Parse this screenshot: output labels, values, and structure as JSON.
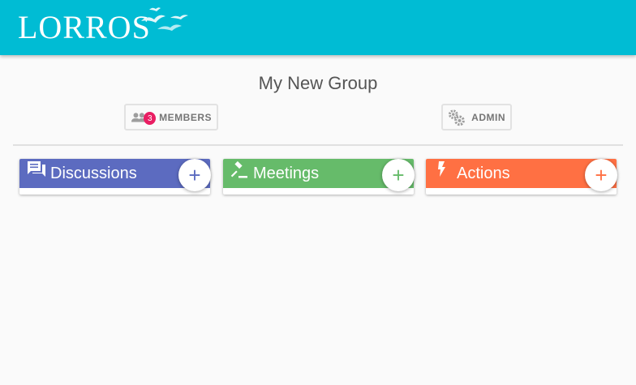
{
  "app": {
    "logo_text": "LORROS",
    "brand_color": "#00bcd4"
  },
  "group": {
    "title": "My New Group"
  },
  "members_button": {
    "count": "3",
    "label": "MEMBERS",
    "icon": "people-icon"
  },
  "admin_button": {
    "label": "ADMIN",
    "icon": "gears-icon"
  },
  "sections": [
    {
      "title": "Discussions",
      "icon": "forum-icon",
      "color": "#5c6bc0",
      "add_label": "+"
    },
    {
      "title": "Meetings",
      "icon": "gavel-icon",
      "color": "#66bb6a",
      "add_label": "+"
    },
    {
      "title": "Actions",
      "icon": "flash-icon",
      "color": "#ff7043",
      "add_label": "+"
    }
  ]
}
